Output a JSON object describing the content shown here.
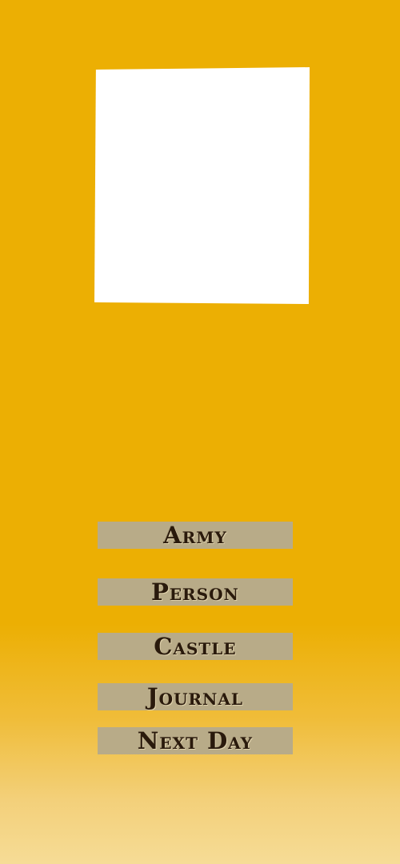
{
  "colors": {
    "background": "#ecaf03",
    "background_bottom": "#f6dc96",
    "image_panel": "#ffffff",
    "button_bg": "#b8ab88",
    "button_text": "#2a1a0c"
  },
  "menu": {
    "items": [
      {
        "label": "Army"
      },
      {
        "label": "Person"
      },
      {
        "label": "Castle"
      },
      {
        "label": "Journal"
      },
      {
        "label": "Next Day"
      }
    ]
  }
}
